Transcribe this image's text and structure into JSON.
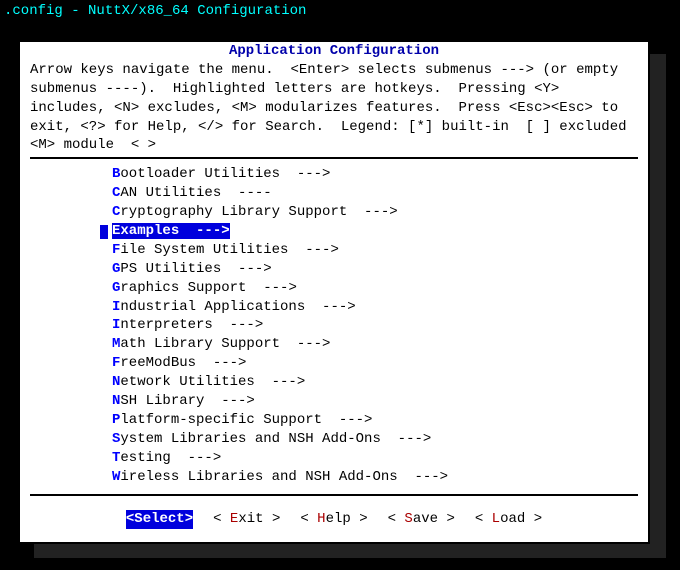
{
  "titlebar": ".config - NuttX/x86_64 Configuration",
  "breadcrumb_prefix": "→ ",
  "breadcrumb": "Application Configuration",
  "dialog_title": "Application Configuration",
  "help_text": "Arrow keys navigate the menu.  <Enter> selects submenus ---> (or empty submenus ----).  Highlighted letters are hotkeys.  Pressing <Y> includes, <N> excludes, <M> modularizes features.  Press <Esc><Esc> to exit, <?> for Help, </> for Search.  Legend: [*] built-in  [ ] excluded  <M> module  < >",
  "menu_items": [
    {
      "hotkey": "B",
      "rest": "ootloader Utilities",
      "arrow": "  --->",
      "selected": false
    },
    {
      "hotkey": "C",
      "rest": "AN Utilities",
      "arrow": "  ----",
      "selected": false
    },
    {
      "hotkey": "C",
      "rest": "ryptography Library Support",
      "arrow": "  --->",
      "selected": false
    },
    {
      "hotkey": "E",
      "rest": "xamples",
      "arrow": "  --->",
      "selected": true
    },
    {
      "hotkey": "F",
      "rest": "ile System Utilities",
      "arrow": "  --->",
      "selected": false
    },
    {
      "hotkey": "G",
      "rest": "PS Utilities",
      "arrow": "  --->",
      "selected": false
    },
    {
      "hotkey": "G",
      "rest": "raphics Support",
      "arrow": "  --->",
      "selected": false
    },
    {
      "hotkey": "I",
      "rest": "ndustrial Applications",
      "arrow": "  --->",
      "selected": false
    },
    {
      "hotkey": "I",
      "rest": "nterpreters",
      "arrow": "  --->",
      "selected": false
    },
    {
      "hotkey": "M",
      "rest": "ath Library Support",
      "arrow": "  --->",
      "selected": false
    },
    {
      "hotkey": "F",
      "rest": "reeModBus",
      "arrow": "  --->",
      "selected": false
    },
    {
      "hotkey": "N",
      "rest": "etwork Utilities",
      "arrow": "  --->",
      "selected": false
    },
    {
      "hotkey": "N",
      "rest": "SH Library",
      "arrow": "  --->",
      "selected": false
    },
    {
      "hotkey": "P",
      "rest": "latform-specific Support",
      "arrow": "  --->",
      "selected": false
    },
    {
      "hotkey": "S",
      "rest": "ystem Libraries and NSH Add-Ons",
      "arrow": "  --->",
      "selected": false
    },
    {
      "hotkey": "T",
      "rest": "esting",
      "arrow": "  --->",
      "selected": false
    },
    {
      "hotkey": "W",
      "rest": "ireless Libraries and NSH Add-Ons",
      "arrow": "  --->",
      "selected": false
    }
  ],
  "buttons": [
    {
      "label": "Select",
      "hot": "S",
      "tail": "elect",
      "active": true
    },
    {
      "label": "Exit",
      "hot": "E",
      "tail": "xit",
      "active": false
    },
    {
      "label": "Help",
      "hot": "H",
      "tail": "elp",
      "active": false
    },
    {
      "label": "Save",
      "hot": "S",
      "tail": "ave",
      "active": false
    },
    {
      "label": "Load",
      "hot": "L",
      "tail": "oad",
      "active": false
    }
  ]
}
